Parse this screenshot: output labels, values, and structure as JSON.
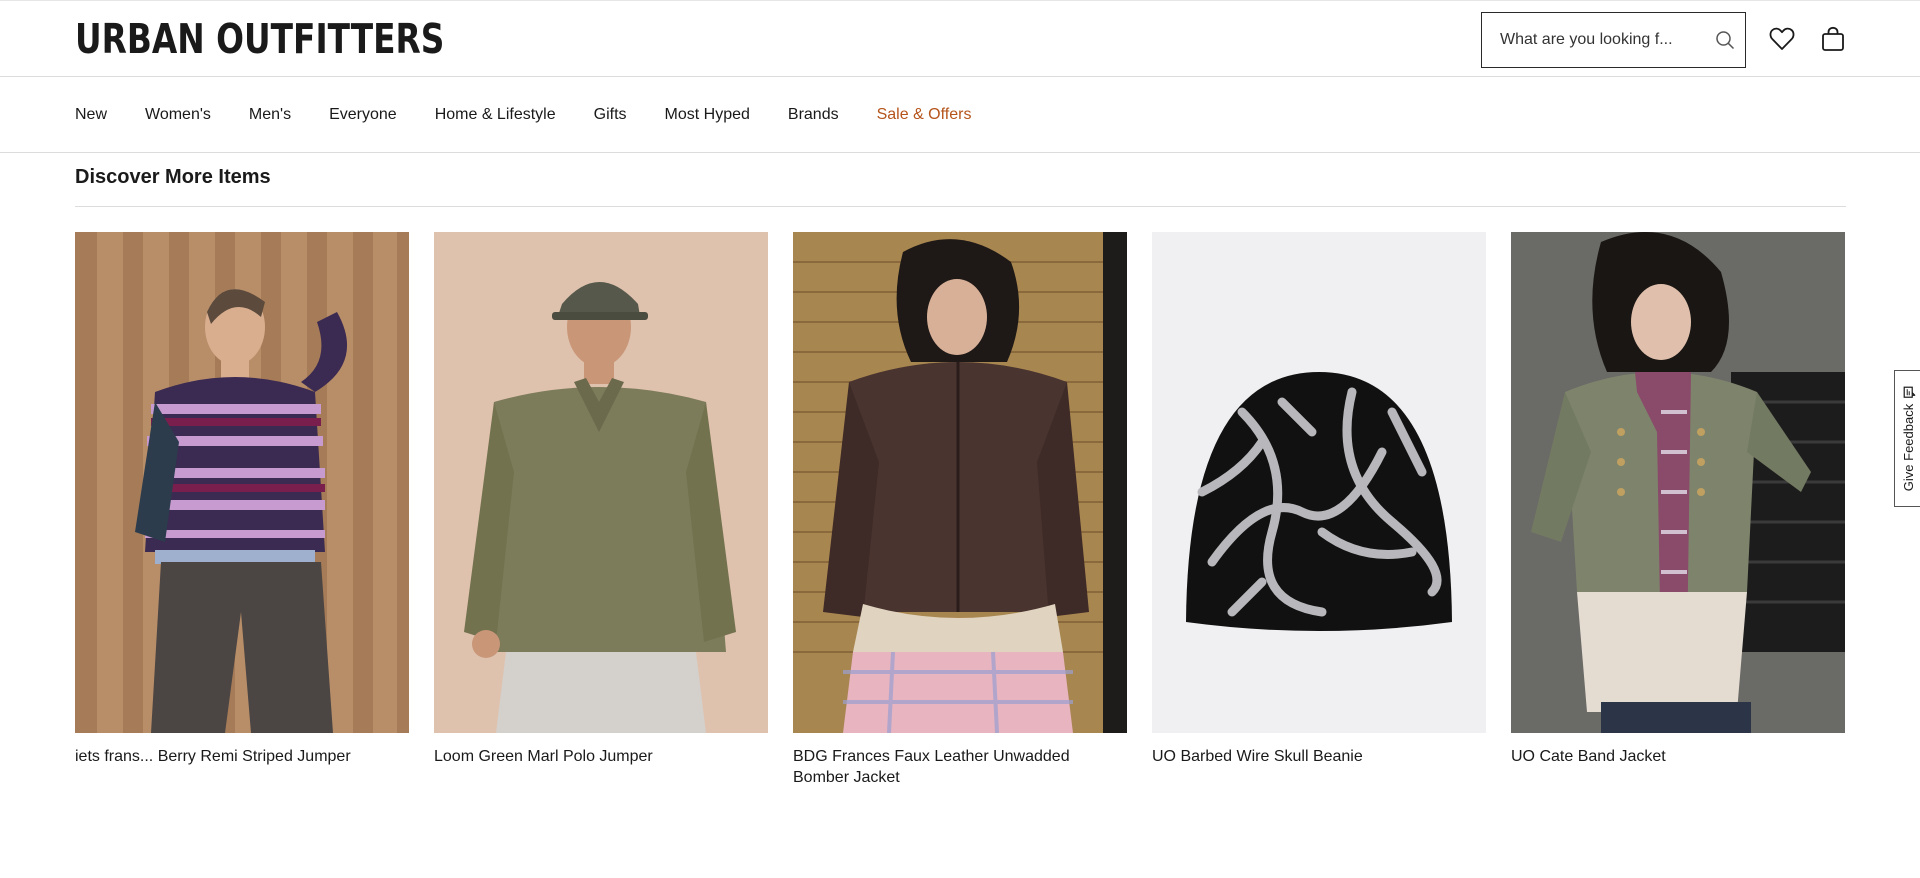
{
  "header": {
    "logo": "URBAN OUTFITTERS",
    "search_placeholder": "What are you looking f...",
    "icons": [
      "search-icon",
      "heart-icon",
      "shopping-bag-icon"
    ]
  },
  "nav": {
    "items": [
      {
        "label": "New"
      },
      {
        "label": "Women's"
      },
      {
        "label": "Men's"
      },
      {
        "label": "Everyone"
      },
      {
        "label": "Home & Lifestyle"
      },
      {
        "label": "Gifts"
      },
      {
        "label": "Most Hyped"
      },
      {
        "label": "Brands"
      },
      {
        "label": "Sale & Offers",
        "accent": "#b5541a"
      }
    ]
  },
  "section": {
    "title": "Discover More Items"
  },
  "products": [
    {
      "name": "iets frans... Berry Remi Striped Jumper"
    },
    {
      "name": "Loom Green Marl Polo Jumper"
    },
    {
      "name": "BDG Frances Faux Leather Unwadded Bomber Jacket"
    },
    {
      "name": "UO Barbed Wire Skull Beanie"
    },
    {
      "name": "UO Cate Band Jacket"
    }
  ],
  "feedback": {
    "label": "Give Feedback",
    "icon": "comment-icon"
  },
  "colors": {
    "text": "#1a1a1a",
    "sale_accent": "#b5541a",
    "border": "#dcdcdc"
  }
}
